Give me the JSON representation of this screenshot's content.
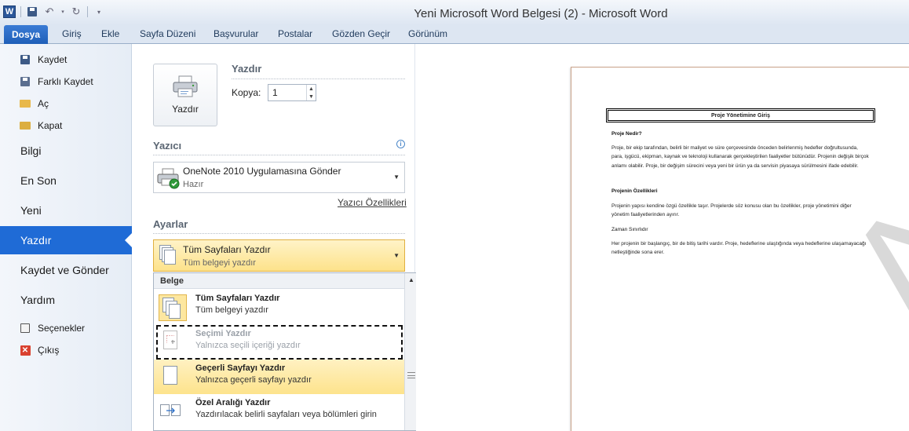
{
  "window": {
    "title": "Yeni Microsoft Word Belgesi (2)  -  Microsoft Word",
    "app_icon": "W"
  },
  "ribbon": {
    "file_tab": "Dosya",
    "tabs": [
      "Giriş",
      "Ekle",
      "Sayfa Düzeni",
      "Başvurular",
      "Postalar",
      "Gözden Geçir",
      "Görünüm"
    ]
  },
  "nav": {
    "small_items": [
      {
        "label": "Kaydet",
        "icon": "save-icon"
      },
      {
        "label": "Farklı Kaydet",
        "icon": "save-as-icon"
      },
      {
        "label": "Aç",
        "icon": "open-folder-icon"
      },
      {
        "label": "Kapat",
        "icon": "close-folder-icon"
      }
    ],
    "big_items": [
      "Bilgi",
      "En Son",
      "Yeni",
      "Yazdır",
      "Kaydet ve Gönder",
      "Yardım"
    ],
    "active": "Yazdır",
    "bottom_items": [
      {
        "label": "Seçenekler",
        "icon": "options-icon"
      },
      {
        "label": "Çıkış",
        "icon": "exit-icon"
      }
    ]
  },
  "print": {
    "section_title": "Yazdır",
    "button_label": "Yazdır",
    "copies_label": "Kopya:",
    "copies_value": "1"
  },
  "printer": {
    "section_title": "Yazıcı",
    "name": "OneNote 2010 Uygulamasına Gönder",
    "status": "Hazır",
    "properties_link": "Yazıcı Özellikleri"
  },
  "settings": {
    "section_title": "Ayarlar",
    "selected_title": "Tüm Sayfaları Yazdır",
    "selected_desc": "Tüm belgeyi yazdır"
  },
  "dropdown": {
    "group_header": "Belge",
    "options": [
      {
        "title": "Tüm Sayfaları Yazdır",
        "desc": "Tüm belgeyi yazdır"
      },
      {
        "title": "Seçimi Yazdır",
        "desc": "Yalnızca seçili içeriği yazdır"
      },
      {
        "title": "Geçerli Sayfayı Yazdır",
        "desc": "Yalnızca geçerli sayfayı yazdır"
      },
      {
        "title": "Özel Aralığı Yazdır",
        "desc": "Yazdırılacak belirli sayfaları veya bölümleri girin"
      }
    ]
  },
  "preview": {
    "doc_title": "Proje Yönetimine Giriş",
    "h1": "Proje Nedir?",
    "p1": "Proje, bir ekip tarafından, belirli bir maliyet ve süre çerçevesinde önceden belirlenmiş hedefler doğrultusunda, para, işgücü, ekipman, kaynak ve teknoloji kullanarak gerçekleştirilen faaliyetler bütünüdür. Projenin değişik birçok anlamı olabilir. Proje, bir değişim sürecini veya yeni bir ürün ya da servisin piyasaya sürülmesini ifade edebilir.",
    "h2": "Projenin Özellikleri",
    "p2": "Projenin yapısı kendine özgü özellikle taşır. Projelerde söz konusu olan bu özellikler, proje yönetimini diğer yönetim faaliyetlerinden ayırır.",
    "h3": "Zaman Sınırlıdır",
    "p3": "Her projenin bir başlangıç, bir de bitiş tarihi vardır. Proje, hedeflerine ulaştığında veya hedeflerine ulaşamayacağı netleştiğinde sona erer.",
    "watermark": "ACİL"
  }
}
